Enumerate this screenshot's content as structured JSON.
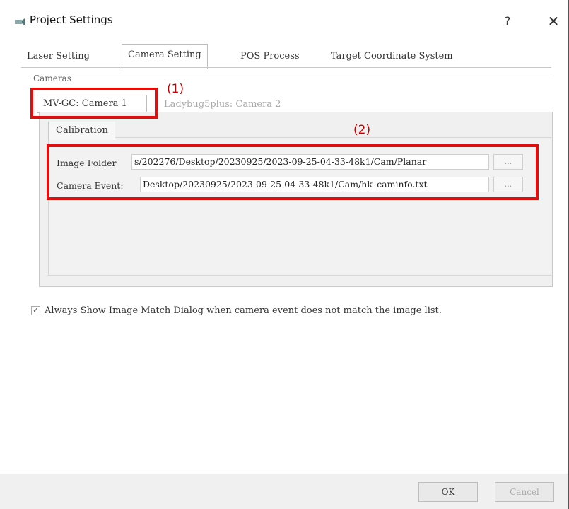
{
  "window": {
    "title": "Project Settings",
    "help_label": "?",
    "close_label": "✕"
  },
  "tabs": [
    {
      "label": "Laser Setting",
      "active": false
    },
    {
      "label": "Camera Setting",
      "active": true
    },
    {
      "label": "POS Process",
      "active": false
    },
    {
      "label": "Target Coordinate System",
      "active": false
    }
  ],
  "cameras": {
    "group_label": "Cameras",
    "tabs": [
      {
        "label": "MV-GC: Camera 1",
        "active": true
      },
      {
        "label": "Ladybug5plus: Camera 2",
        "active": false
      }
    ],
    "sub_tab": "Calibration",
    "image_folder": {
      "label": "Image Folder",
      "value": "s/202276/Desktop/20230925/2023-09-25-04-33-48k1/Cam/Planar",
      "browse_label": "..."
    },
    "camera_event": {
      "label": "Camera Event:",
      "value": "Desktop/20230925/2023-09-25-04-33-48k1/Cam/hk_caminfo.txt",
      "browse_label": "..."
    }
  },
  "always_show": {
    "checked": true,
    "check_mark": "✓",
    "label": "Always Show Image Match Dialog when camera event does not match the image list."
  },
  "annotations": [
    {
      "label": "(1)"
    },
    {
      "label": "(2)"
    }
  ],
  "buttons": {
    "ok": "OK",
    "cancel": "Cancel"
  },
  "colors": {
    "annotation": "#e20e0e"
  }
}
